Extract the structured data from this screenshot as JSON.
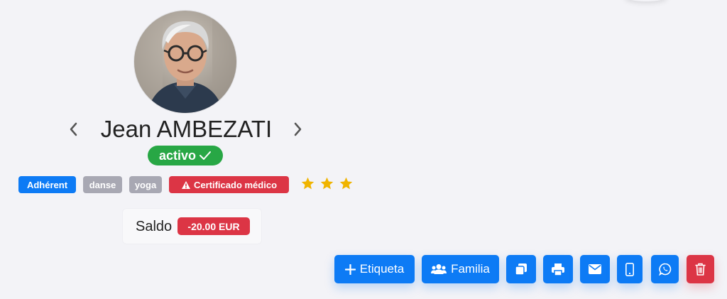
{
  "profile": {
    "name": "Jean AMBEZATI",
    "status": "activo",
    "avatar_icon": "person-photo",
    "rating": 3,
    "rating_icon": "star-icon",
    "rating_color": "#f0b400"
  },
  "navigation": {
    "prev_icon": "chevron-left-icon",
    "next_icon": "chevron-right-icon"
  },
  "tags": [
    {
      "label": "Adhérent",
      "color": "#0d7bf5"
    },
    {
      "label": "danse",
      "color": "#a8a8b3"
    },
    {
      "label": "yoga",
      "color": "#a8a8b3"
    },
    {
      "label": "Certificado médico",
      "color": "#dc3545",
      "icon": "warning-icon"
    }
  ],
  "balance": {
    "label": "Saldo",
    "value": "-20.00 EUR"
  },
  "actions": {
    "add_label_button": "Etiqueta",
    "family_button": "Familia",
    "icons": [
      "plus-icon",
      "users-icon",
      "copy-icon",
      "print-icon",
      "envelope-icon",
      "mobile-icon",
      "whatsapp-icon",
      "trash-icon"
    ]
  },
  "colors": {
    "primary": "#0d7bf5",
    "success": "#28a745",
    "danger": "#dc3545",
    "secondary": "#a8a8b3"
  }
}
